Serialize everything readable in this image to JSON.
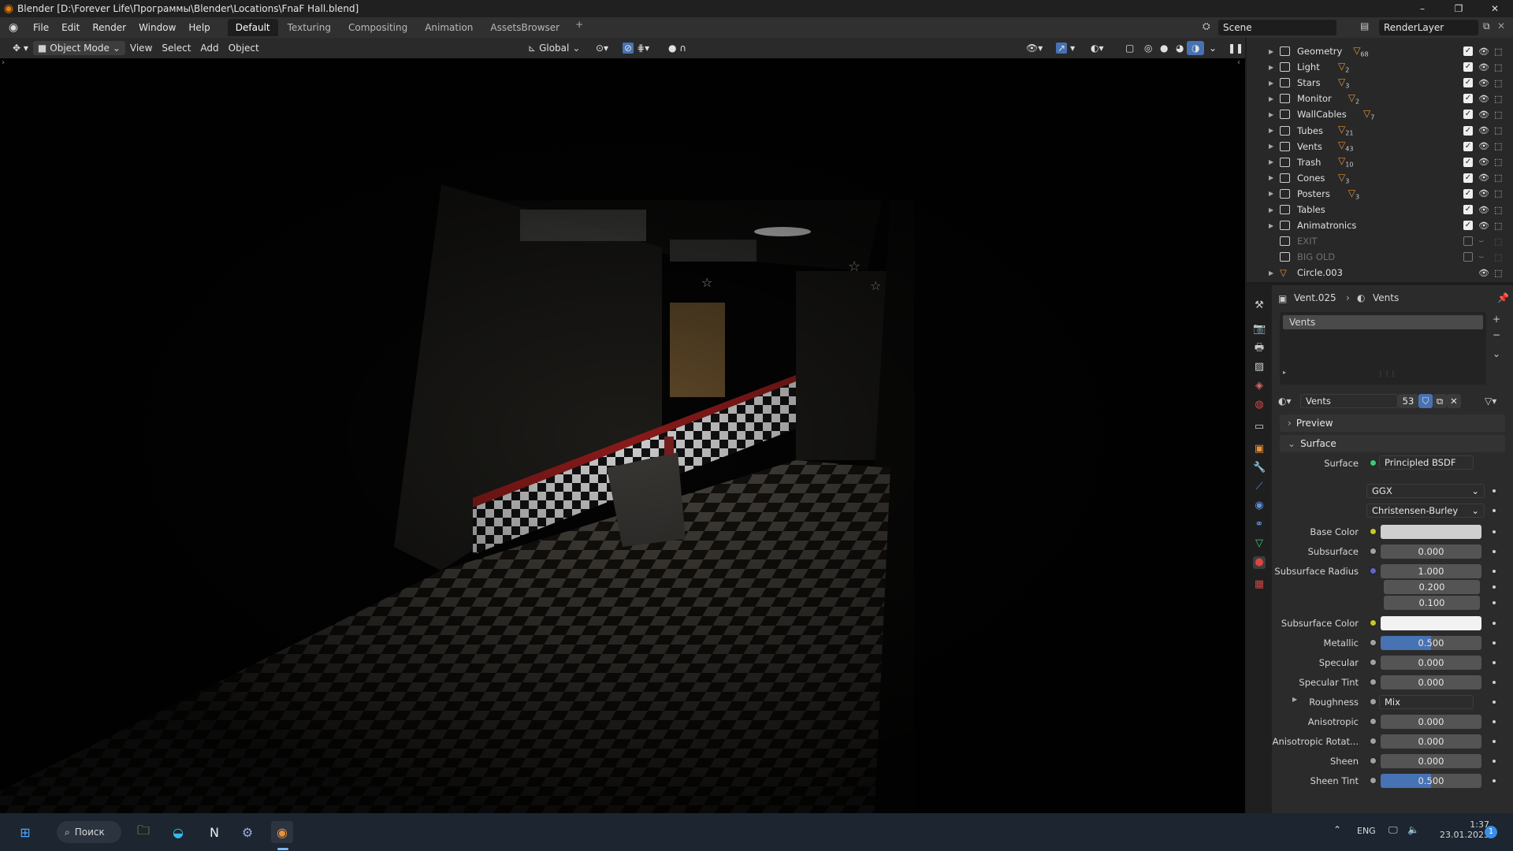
{
  "window": {
    "title": "Blender [D:\\Forever Life\\Программы\\Blender\\Locations\\FnaF Hall.blend]",
    "controls": [
      "–",
      "❐",
      "✕"
    ]
  },
  "menubar": {
    "menus": [
      "File",
      "Edit",
      "Render",
      "Window",
      "Help"
    ],
    "workspaces": [
      "Default",
      "Texturing",
      "Compositing",
      "Animation",
      "AssetsBrowser"
    ],
    "active_workspace": "Default",
    "scene": "Scene",
    "view_layer": "RenderLayer"
  },
  "viewport_header": {
    "mode": "Object Mode",
    "menus": [
      "View",
      "Select",
      "Add",
      "Object"
    ],
    "transform_orientation": "Global"
  },
  "outliner": {
    "items": [
      {
        "name": "Geometry",
        "badge": "68",
        "enabled": true
      },
      {
        "name": "Light",
        "badge": "2",
        "enabled": true
      },
      {
        "name": "Stars",
        "badge": "3",
        "enabled": true
      },
      {
        "name": "Monitor",
        "badge": "2",
        "enabled": true
      },
      {
        "name": "WallCables",
        "badge": "7",
        "enabled": true
      },
      {
        "name": "Tubes",
        "badge": "21",
        "enabled": true
      },
      {
        "name": "Vents",
        "badge": "43",
        "enabled": true
      },
      {
        "name": "Trash",
        "badge": "10",
        "enabled": true
      },
      {
        "name": "Cones",
        "badge": "3",
        "enabled": true
      },
      {
        "name": "Posters",
        "badge": "3",
        "enabled": true
      },
      {
        "name": "Tables",
        "badge": "",
        "enabled": true
      },
      {
        "name": "Animatronics",
        "badge": "",
        "enabled": true
      },
      {
        "name": "EXIT",
        "badge": "",
        "enabled": false
      },
      {
        "name": "BIG OLD",
        "badge": "",
        "enabled": false
      },
      {
        "name": "Circle.003",
        "badge": "",
        "enabled": true
      }
    ]
  },
  "properties": {
    "breadcrumb_object": "Vent.025",
    "breadcrumb_material": "Vents",
    "slot_name": "Vents",
    "material_name": "Vents",
    "user_count": "53",
    "sections": {
      "preview": "Preview",
      "surface": "Surface"
    },
    "surface_label": "Surface",
    "surface_value": "Principled BSDF",
    "distribution": "GGX",
    "subsurface_method": "Christensen-Burley",
    "rows": [
      {
        "label": "Base Color",
        "value": "",
        "kind": "swatch",
        "sock": "#c7c729"
      },
      {
        "label": "Subsurface",
        "value": "0.000",
        "kind": "num",
        "sock": "#a1a1a1"
      },
      {
        "label": "Subsurface Radius",
        "value": "1.000",
        "kind": "num",
        "sock": "#6363c7"
      },
      {
        "label": "",
        "value": "0.200",
        "kind": "num",
        "sock": ""
      },
      {
        "label": "",
        "value": "0.100",
        "kind": "num",
        "sock": ""
      },
      {
        "label": "Subsurface Color",
        "value": "",
        "kind": "swatch2",
        "sock": "#c7c729"
      },
      {
        "label": "Metallic",
        "value": "0.500",
        "kind": "blue",
        "sock": "#a1a1a1"
      },
      {
        "label": "Specular",
        "value": "0.000",
        "kind": "num",
        "sock": "#a1a1a1"
      },
      {
        "label": "Specular Tint",
        "value": "0.000",
        "kind": "num",
        "sock": "#a1a1a1"
      },
      {
        "label": "Roughness",
        "value": "Mix",
        "kind": "link",
        "sock": "#a1a1a1"
      },
      {
        "label": "Anisotropic",
        "value": "0.000",
        "kind": "num",
        "sock": "#a1a1a1"
      },
      {
        "label": "Anisotropic Rotat...",
        "value": "0.000",
        "kind": "num",
        "sock": "#a1a1a1"
      },
      {
        "label": "Sheen",
        "value": "0.000",
        "kind": "num",
        "sock": "#a1a1a1"
      },
      {
        "label": "Sheen Tint",
        "value": "0.500",
        "kind": "blue",
        "sock": "#a1a1a1"
      }
    ]
  },
  "taskbar": {
    "search_label": "Поиск",
    "language": "ENG",
    "time": "1:37",
    "date": "23.01.2023",
    "notifications": "1"
  }
}
